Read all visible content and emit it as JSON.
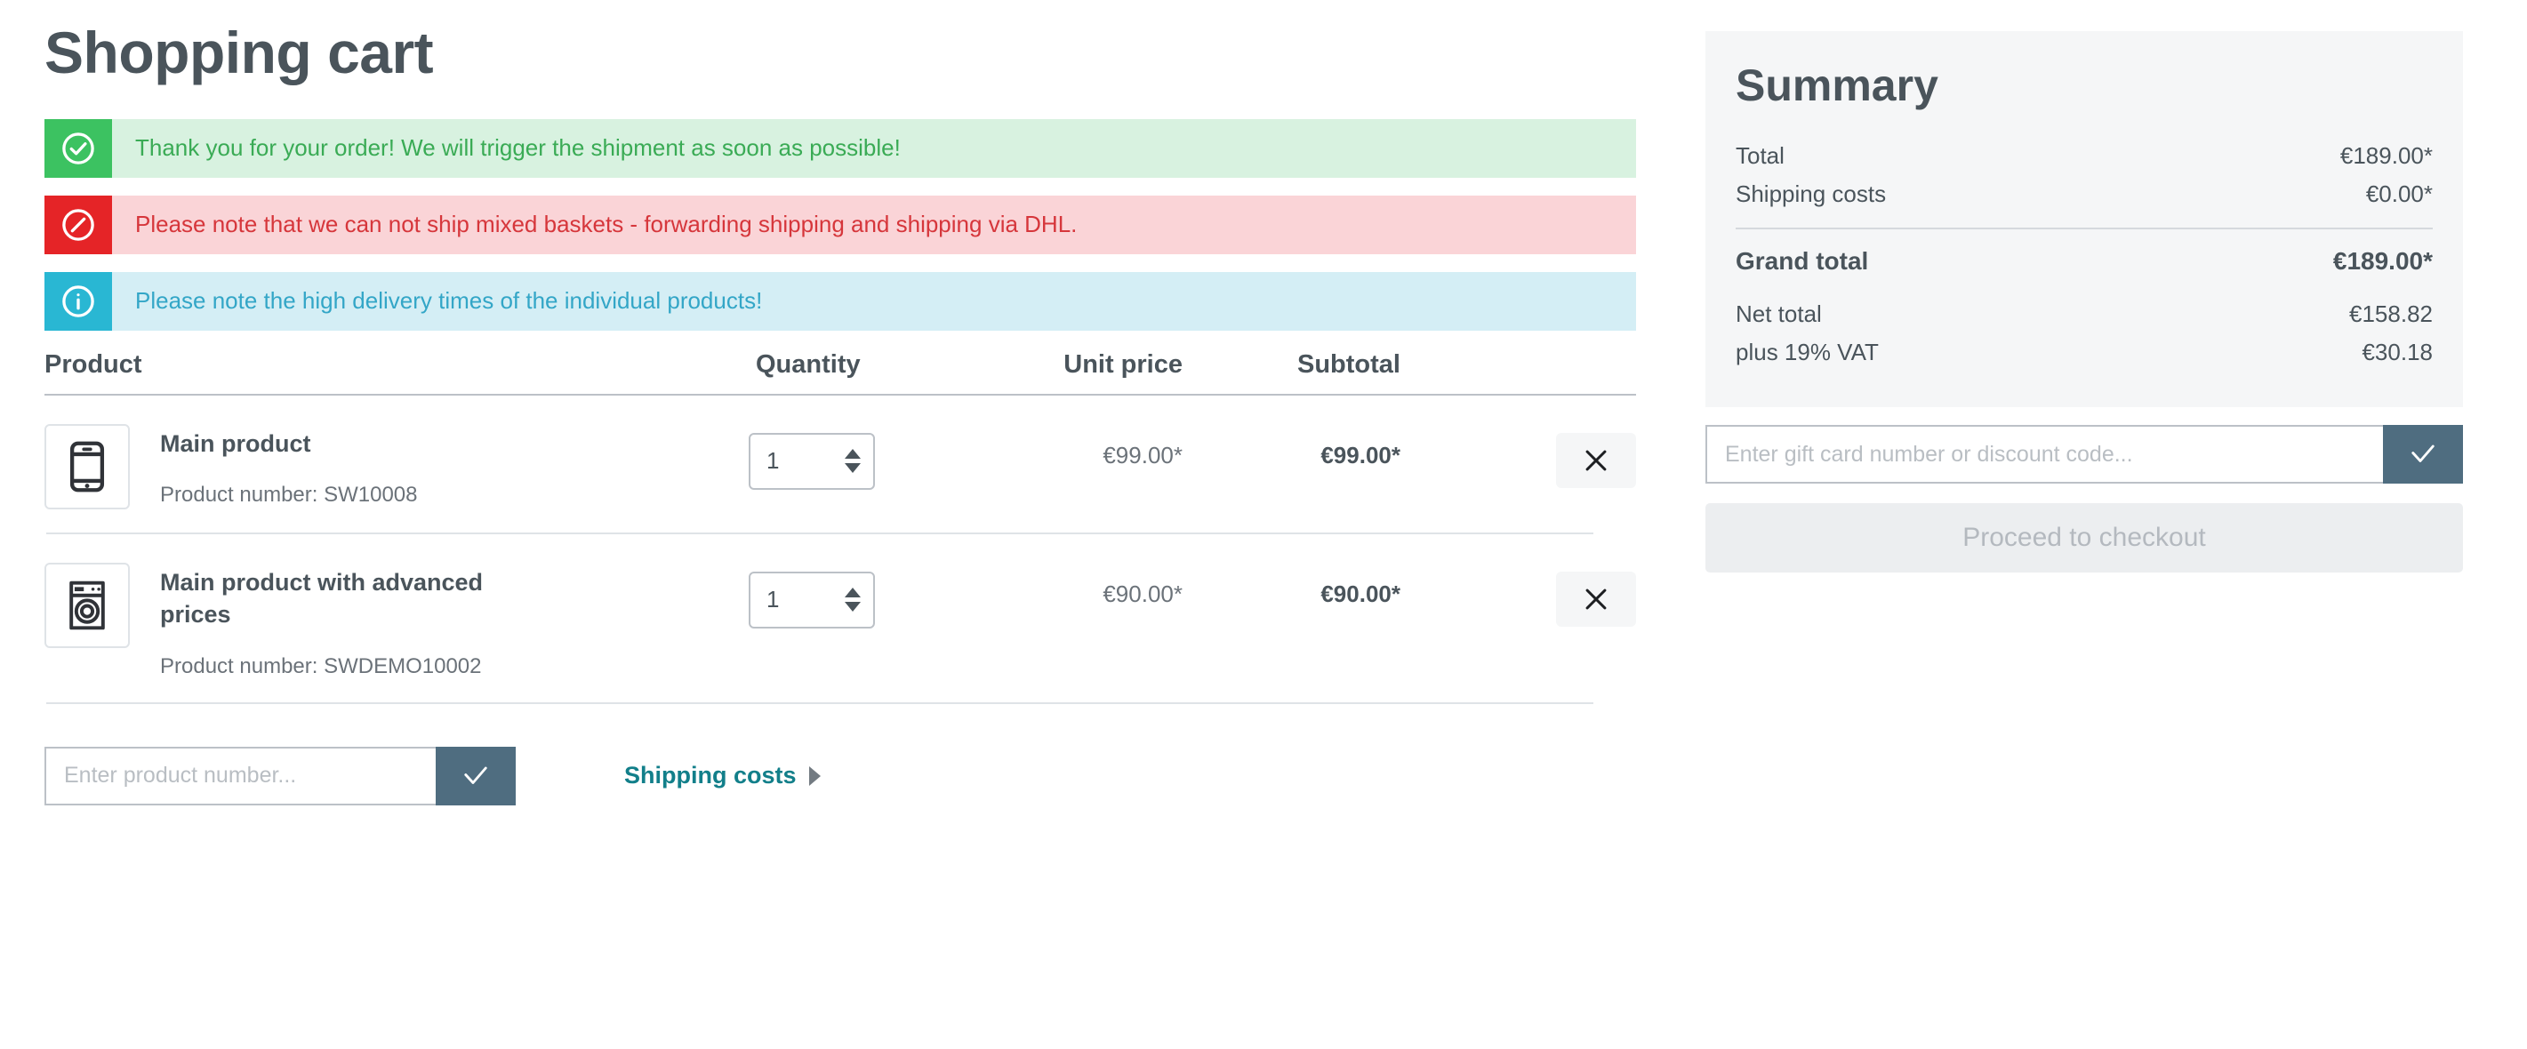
{
  "page": {
    "title": "Shopping cart"
  },
  "alerts": [
    {
      "type": "success",
      "icon": "check-circle-icon",
      "message": "Thank you for your order! We will trigger the shipment as soon as possible!",
      "bg": "#d8f2e0",
      "icon_bg": "#3cc261",
      "text_color": "#3aab55"
    },
    {
      "type": "danger",
      "icon": "blocked-circle-icon",
      "message": "Please note that we can not ship mixed baskets - forwarding shipping and shipping via DHL.",
      "bg": "#fad4d7",
      "icon_bg": "#e52427",
      "text_color": "#d6363b"
    },
    {
      "type": "info",
      "icon": "info-circle-icon",
      "message": "Please note the high delivery times of the individual products!",
      "bg": "#d4eef5",
      "icon_bg": "#29b7d3",
      "text_color": "#33a6c7"
    }
  ],
  "table": {
    "headers": {
      "product": "Product",
      "quantity": "Quantity",
      "unit_price": "Unit price",
      "subtotal": "Subtotal"
    },
    "rows": [
      {
        "thumb_icon": "smartphone-icon",
        "name": "Main product",
        "product_number_label": "Product number: SW10008",
        "quantity": "1",
        "unit_price": "€99.00*",
        "subtotal": "€99.00*",
        "remove_icon": "close-icon"
      },
      {
        "thumb_icon": "washing-machine-icon",
        "name": "Main product with advanced prices",
        "product_number_label": "Product number: SWDEMO10002",
        "quantity": "1",
        "unit_price": "€90.00*",
        "subtotal": "€90.00*",
        "remove_icon": "close-icon"
      }
    ]
  },
  "footer": {
    "product_number_placeholder": "Enter product number...",
    "product_number_value": "",
    "submit_icon": "check-icon",
    "shipping_costs_label": "Shipping costs",
    "shipping_costs_chevron": "chevron-right-icon",
    "link_color": "#127f8a"
  },
  "summary": {
    "title": "Summary",
    "lines": [
      {
        "label": "Total",
        "value": "€189.00*"
      },
      {
        "label": "Shipping costs",
        "value": "€0.00*"
      }
    ],
    "grand_total": {
      "label": "Grand total",
      "value": "€189.00*"
    },
    "tax_lines": [
      {
        "label": "Net total",
        "value": "€158.82"
      },
      {
        "label": "plus 19% VAT",
        "value": "€30.18"
      }
    ],
    "gift_card_placeholder": "Enter gift card number or discount code...",
    "gift_card_value": "",
    "gift_submit_icon": "check-icon",
    "checkout_label": "Proceed to checkout",
    "accent_color": "#4f6d80",
    "panel_bg": "#f5f6f7"
  }
}
